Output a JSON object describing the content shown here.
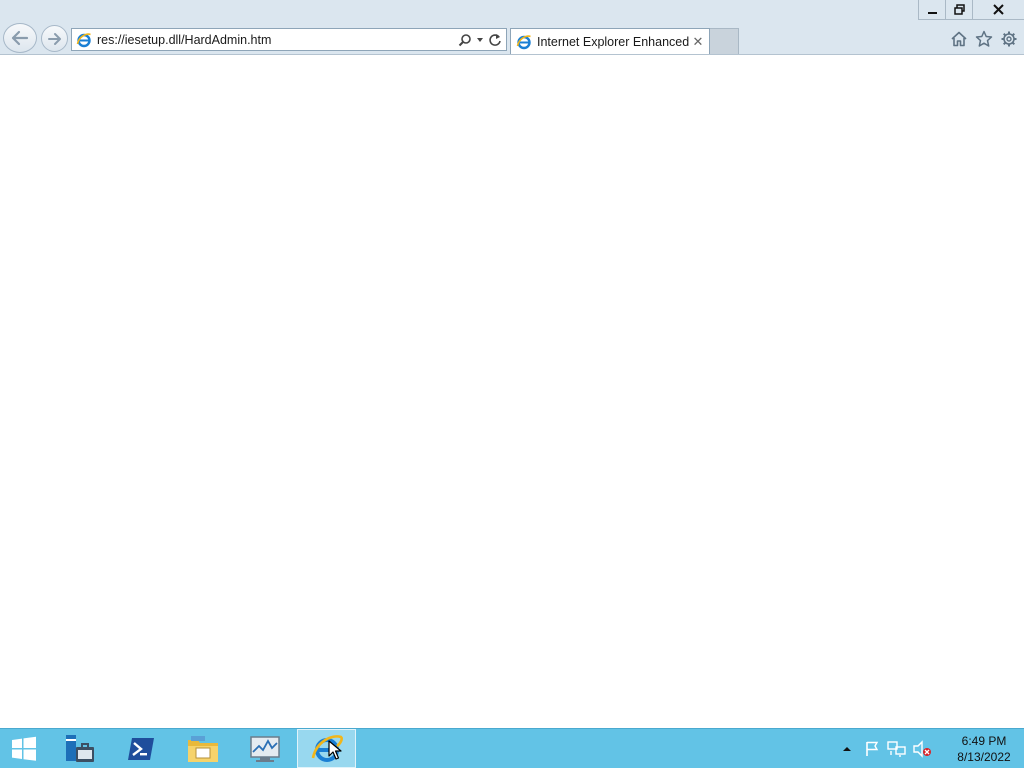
{
  "window": {
    "controls": {
      "minimize": "minimize",
      "restore": "restore",
      "close": "close"
    }
  },
  "navigation": {
    "back_icon": "back-arrow-icon",
    "forward_icon": "forward-arrow-icon"
  },
  "address_bar": {
    "url": "res://iesetup.dll/HardAdmin.htm",
    "favicon": "ie-page-icon",
    "tools": [
      "search-icon",
      "dropdown-icon",
      "refresh-icon"
    ]
  },
  "tabs": [
    {
      "title": "Internet Explorer Enhanced ...",
      "active": true,
      "close_glyph": "✕"
    }
  ],
  "command_icons": [
    "home-icon",
    "favorites-star-icon",
    "tools-gear-icon"
  ],
  "taskbar": {
    "start": "windows-start-icon",
    "items": [
      {
        "name": "server-manager-icon",
        "active": false
      },
      {
        "name": "powershell-icon",
        "active": false
      },
      {
        "name": "file-explorer-icon",
        "active": false
      },
      {
        "name": "performance-monitor-icon",
        "active": false
      },
      {
        "name": "internet-explorer-icon",
        "active": true
      }
    ],
    "tray": [
      "show-hidden-icons-arrow",
      "action-center-flag-icon",
      "network-icon",
      "volume-muted-icon"
    ],
    "clock": {
      "time": "6:49 PM",
      "date": "8/13/2022"
    }
  },
  "colors": {
    "chrome_bg": "#dbe6ef",
    "taskbar_bg": "#62c3e6",
    "ie_blue": "#1a7fd4",
    "ie_gold": "#f2b619",
    "close_red_x": "#d8232a"
  }
}
